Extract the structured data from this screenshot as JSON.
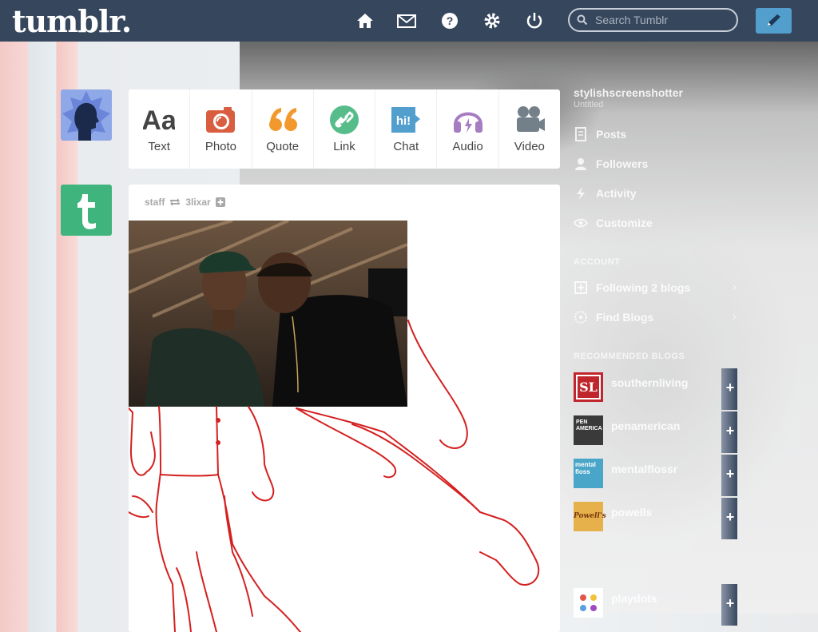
{
  "header": {
    "logo": "tumblr.",
    "nav": [
      "home-icon",
      "inbox-icon",
      "help-icon",
      "settings-icon",
      "power-icon"
    ],
    "search_placeholder": "Search Tumblr"
  },
  "post_types": [
    {
      "label": "Text",
      "icon": "text-icon",
      "color": "#444444"
    },
    {
      "label": "Photo",
      "icon": "camera-icon",
      "color": "#d95e40"
    },
    {
      "label": "Quote",
      "icon": "quote-icon",
      "color": "#f2992e"
    },
    {
      "label": "Link",
      "icon": "link-icon",
      "color": "#56bc8a"
    },
    {
      "label": "Chat",
      "icon": "chat-icon",
      "color": "#529ecc"
    },
    {
      "label": "Audio",
      "icon": "headphones-icon",
      "color": "#a77dc2"
    },
    {
      "label": "Video",
      "icon": "video-camera-icon",
      "color": "#748089"
    }
  ],
  "post": {
    "author": "staff",
    "reblogged_from": "3lixar"
  },
  "sidebar": {
    "blog_name": "stylishscreenshotter",
    "blog_sub": "Untitled",
    "items": [
      {
        "label": "Posts",
        "icon": "posts-icon"
      },
      {
        "label": "Followers",
        "icon": "followers-icon"
      },
      {
        "label": "Activity",
        "icon": "activity-icon"
      },
      {
        "label": "Customize",
        "icon": "eye-icon"
      }
    ],
    "account_heading": "ACCOUNT",
    "account_items": [
      {
        "label": "Following 2 blogs",
        "icon": "following-icon"
      },
      {
        "label": "Find Blogs",
        "icon": "compass-icon"
      }
    ],
    "recommended_heading": "RECOMMENDED BLOGS",
    "recommended": [
      {
        "name": "southernliving",
        "thumb_text": "SL",
        "thumb_color": "#c0272d"
      },
      {
        "name": "penamerican",
        "thumb_text": "PEN AMERICA",
        "thumb_color": "#3a3a3a"
      },
      {
        "name": "mentalflossr",
        "thumb_text": "mental floss",
        "thumb_color": "#4aa6c9"
      },
      {
        "name": "powells",
        "thumb_text": "Powell's",
        "thumb_color": "#e6b04a"
      },
      {
        "name": "playdots",
        "thumb_text": "",
        "thumb_color": "#ffffff"
      }
    ]
  }
}
